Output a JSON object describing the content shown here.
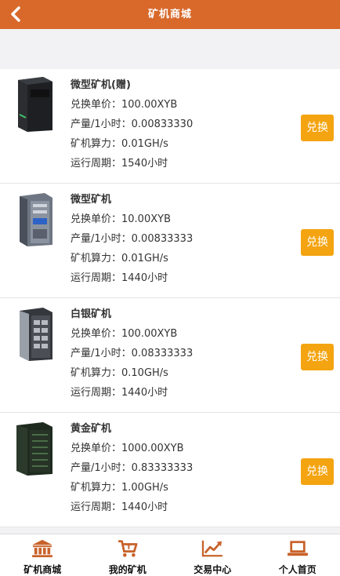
{
  "header": {
    "title": "矿机商城",
    "back_icon": "chevron-left-icon"
  },
  "products": [
    {
      "name": "微型矿机(赠)",
      "price": "兑换单价：100.00XYB",
      "output": "产量/1小时：0.00833330",
      "hashrate": "矿机算力：0.01GH/s",
      "period": "运行周期：1540小时",
      "button": "兑换"
    },
    {
      "name": "微型矿机",
      "price": "兑换单价：10.00XYB",
      "output": "产量/1小时：0.00833333",
      "hashrate": "矿机算力：0.01GH/s",
      "period": "运行周期：1440小时",
      "button": "兑换"
    },
    {
      "name": "白银矿机",
      "price": "兑换单价：100.00XYB",
      "output": "产量/1小时：0.08333333",
      "hashrate": "矿机算力：0.10GH/s",
      "period": "运行周期：1440小时",
      "button": "兑换"
    },
    {
      "name": "黄金矿机",
      "price": "兑换单价：1000.00XYB",
      "output": "产量/1小时：0.83333333",
      "hashrate": "矿机算力：1.00GH/s",
      "period": "运行周期：1440小时",
      "button": "兑换"
    }
  ],
  "tabs": [
    {
      "label": "矿机商城",
      "icon": "bank-icon"
    },
    {
      "label": "我的矿机",
      "icon": "cart-icon"
    },
    {
      "label": "交易中心",
      "icon": "trend-chart-icon"
    },
    {
      "label": "个人首页",
      "icon": "laptop-icon"
    }
  ],
  "colors": {
    "header": "#d8692b",
    "button": "#f4a410",
    "tab_icon": "#c8622a"
  }
}
